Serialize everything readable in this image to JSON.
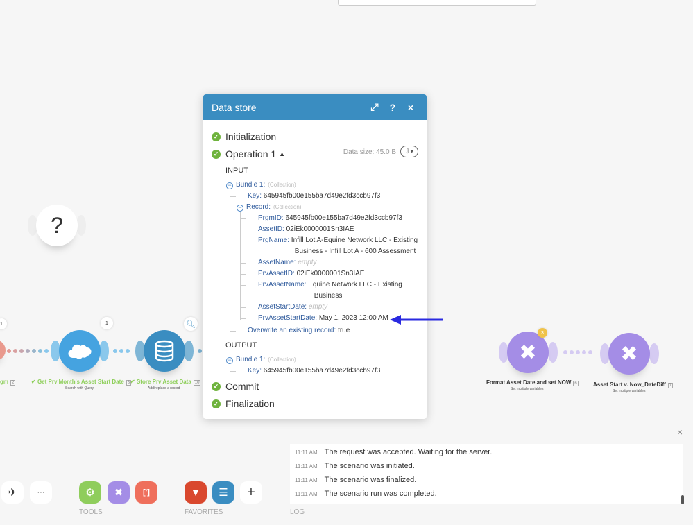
{
  "colors": {
    "accent": "#3a8dc1",
    "success": "#6fb33d",
    "salesforce": "#45a3e0",
    "datastore": "#3a8dc1",
    "tools": "#a48de6",
    "arrow": "#2a2ae0"
  },
  "modal": {
    "title": "Data store",
    "icons": [
      "expand-icon",
      "help-icon",
      "close-icon"
    ],
    "help_label": "?",
    "close_label": "×",
    "steps": {
      "initialization": "Initialization",
      "operation": "Operation 1",
      "commit": "Commit",
      "finalization": "Finalization"
    },
    "data_size": "Data size: 45.0 B",
    "input_label": "INPUT",
    "output_label": "OUTPUT",
    "input": {
      "bundle": "Bundle 1:",
      "collection": "(Collection)",
      "key_label": "Key:",
      "key": "645945fb00e155ba7d49e2fd3ccb97f3",
      "record": "Record:",
      "fields": [
        {
          "k": "PrgmID:",
          "v": "645945fb00e155ba7d49e2fd3ccb97f3"
        },
        {
          "k": "AssetID:",
          "v": "02iEk0000001Sn3IAE"
        },
        {
          "k": "PrgName:",
          "v": "Infill Lot A-Equine Network LLC - Existing",
          "v2": "Business - Infill Lot A - 600 Assessment"
        },
        {
          "k": "AssetName:",
          "empty": "empty"
        },
        {
          "k": "PrvAssetID:",
          "v": "02iEk0000001Sn3IAE"
        },
        {
          "k": "PrvAssetName:",
          "v": "Equine Network LLC - Existing",
          "v2": "Business"
        },
        {
          "k": "AssetStartDate:",
          "empty": "empty"
        },
        {
          "k": "PrvAssetStartDate:",
          "v": "May 1, 2023 12:00 AM"
        }
      ],
      "overwrite_label": "Overwrite an existing record:",
      "overwrite": "true"
    },
    "output": {
      "bundle": "Bundle 1:",
      "collection": "(Collection)",
      "key_label": "Key:",
      "key": "645945fb00e155ba7d49e2fd3ccb97f3"
    }
  },
  "canvas": {
    "left_partial": {
      "label": "gm",
      "num": "2",
      "bubble": "1"
    },
    "nodes": [
      {
        "label": "Get Prv Month's Asset Start Date",
        "num": "3",
        "sub": "Search with Query",
        "bubble": "1",
        "icon": "salesforce-cloud-icon"
      },
      {
        "label": "Store Prv Asset Data",
        "num": "10",
        "sub": "Add/replace a record",
        "icon": "database-icon"
      },
      {
        "label": "Format Asset Date and set NOW",
        "num": "6",
        "sub": "Set multiple variables",
        "badge": "3",
        "icon": "tools-icon"
      },
      {
        "label": "Asset Start v. Now_DateDiff",
        "num": "7",
        "sub": "Set multiple variables",
        "icon": "tools-icon"
      }
    ],
    "router_icon": "question-icon"
  },
  "toolbar": {
    "more": "···",
    "plus": "+",
    "tools_label": "TOOLS",
    "favorites_label": "FAVORITES",
    "log_label": "LOG",
    "json_label": "[']"
  },
  "log": {
    "entries": [
      {
        "time": "11:11 AM",
        "msg": "The request was accepted. Waiting for the server."
      },
      {
        "time": "11:11 AM",
        "msg": "The scenario was initiated."
      },
      {
        "time": "11:11 AM",
        "msg": "The scenario was finalized."
      },
      {
        "time": "11:11 AM",
        "msg": "The scenario run was completed."
      }
    ],
    "close": "×"
  }
}
